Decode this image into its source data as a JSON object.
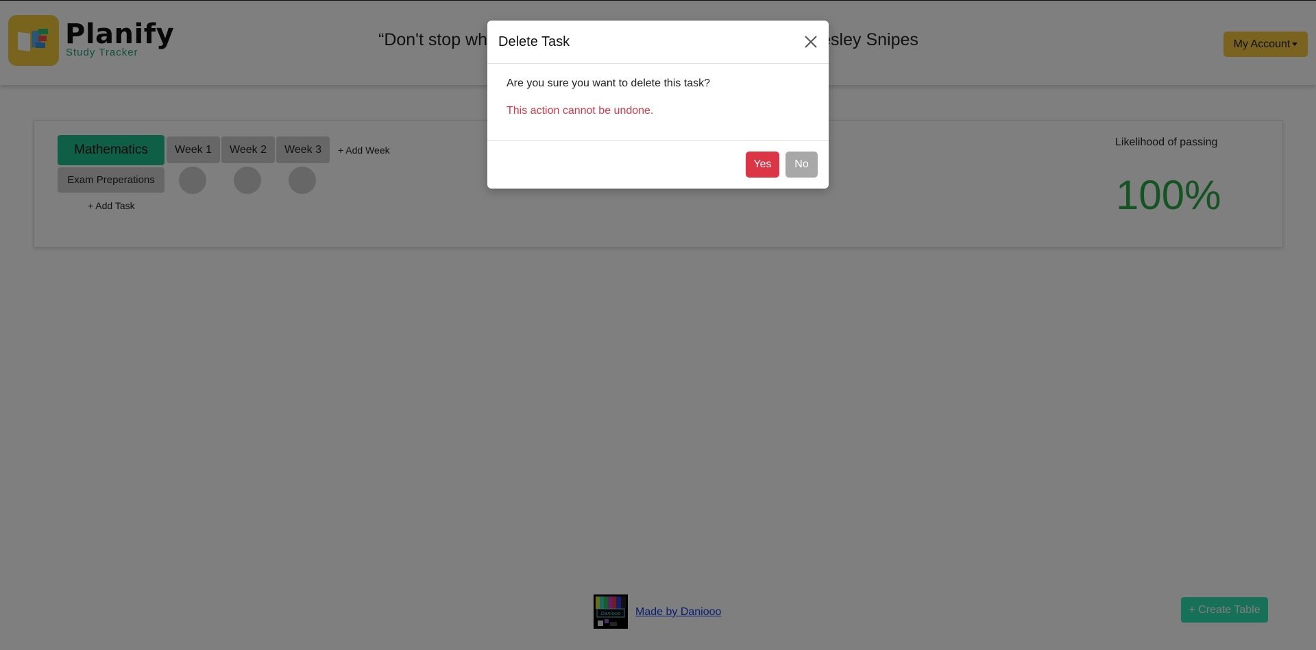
{
  "header": {
    "brand": "Planify",
    "tagline": "Study Tracker",
    "quote": "“Don't stop when you're tired. Stop when you're done.” - Wesley Snipes",
    "account_label": "My Account"
  },
  "tracker": {
    "subject": "Mathematics",
    "weeks": [
      "Week 1",
      "Week 2",
      "Week 3"
    ],
    "add_week_label": "+ Add Week",
    "tasks": [
      "Exam Preperations"
    ],
    "add_task_label": "+ Add Task",
    "likelihood_label": "Likelihood of passing",
    "likelihood_value": "100%"
  },
  "footer": {
    "made_by": "Made by Daniooo",
    "logo_text": "Daniooo",
    "create_table_label": "+ Create Table"
  },
  "modal": {
    "title": "Delete Task",
    "message": "Are you sure you want to delete this task?",
    "warning": "This action cannot be undone.",
    "yes_label": "Yes",
    "no_label": "No"
  },
  "colors": {
    "brand_yellow": "#f3c73c",
    "brand_green": "#1fbf8f",
    "danger": "#dc3545",
    "success": "#28a745",
    "create_button": "#2fe0b0"
  }
}
